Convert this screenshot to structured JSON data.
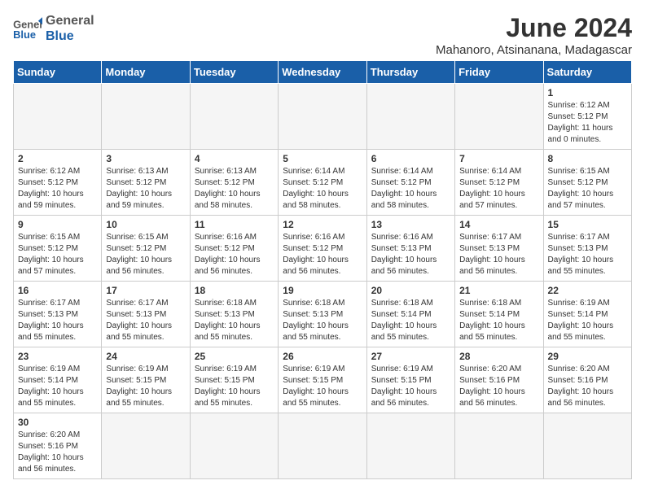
{
  "header": {
    "logo_general": "General",
    "logo_blue": "Blue",
    "title": "June 2024",
    "subtitle": "Mahanoro, Atsinanana, Madagascar"
  },
  "weekdays": [
    "Sunday",
    "Monday",
    "Tuesday",
    "Wednesday",
    "Thursday",
    "Friday",
    "Saturday"
  ],
  "weeks": [
    [
      {
        "day": "",
        "info": ""
      },
      {
        "day": "",
        "info": ""
      },
      {
        "day": "",
        "info": ""
      },
      {
        "day": "",
        "info": ""
      },
      {
        "day": "",
        "info": ""
      },
      {
        "day": "",
        "info": ""
      },
      {
        "day": "1",
        "info": "Sunrise: 6:12 AM\nSunset: 5:12 PM\nDaylight: 11 hours\nand 0 minutes."
      }
    ],
    [
      {
        "day": "2",
        "info": "Sunrise: 6:12 AM\nSunset: 5:12 PM\nDaylight: 10 hours\nand 59 minutes."
      },
      {
        "day": "3",
        "info": "Sunrise: 6:13 AM\nSunset: 5:12 PM\nDaylight: 10 hours\nand 59 minutes."
      },
      {
        "day": "4",
        "info": "Sunrise: 6:13 AM\nSunset: 5:12 PM\nDaylight: 10 hours\nand 58 minutes."
      },
      {
        "day": "5",
        "info": "Sunrise: 6:14 AM\nSunset: 5:12 PM\nDaylight: 10 hours\nand 58 minutes."
      },
      {
        "day": "6",
        "info": "Sunrise: 6:14 AM\nSunset: 5:12 PM\nDaylight: 10 hours\nand 58 minutes."
      },
      {
        "day": "7",
        "info": "Sunrise: 6:14 AM\nSunset: 5:12 PM\nDaylight: 10 hours\nand 57 minutes."
      },
      {
        "day": "8",
        "info": "Sunrise: 6:15 AM\nSunset: 5:12 PM\nDaylight: 10 hours\nand 57 minutes."
      }
    ],
    [
      {
        "day": "9",
        "info": "Sunrise: 6:15 AM\nSunset: 5:12 PM\nDaylight: 10 hours\nand 57 minutes."
      },
      {
        "day": "10",
        "info": "Sunrise: 6:15 AM\nSunset: 5:12 PM\nDaylight: 10 hours\nand 56 minutes."
      },
      {
        "day": "11",
        "info": "Sunrise: 6:16 AM\nSunset: 5:12 PM\nDaylight: 10 hours\nand 56 minutes."
      },
      {
        "day": "12",
        "info": "Sunrise: 6:16 AM\nSunset: 5:12 PM\nDaylight: 10 hours\nand 56 minutes."
      },
      {
        "day": "13",
        "info": "Sunrise: 6:16 AM\nSunset: 5:13 PM\nDaylight: 10 hours\nand 56 minutes."
      },
      {
        "day": "14",
        "info": "Sunrise: 6:17 AM\nSunset: 5:13 PM\nDaylight: 10 hours\nand 56 minutes."
      },
      {
        "day": "15",
        "info": "Sunrise: 6:17 AM\nSunset: 5:13 PM\nDaylight: 10 hours\nand 55 minutes."
      }
    ],
    [
      {
        "day": "16",
        "info": "Sunrise: 6:17 AM\nSunset: 5:13 PM\nDaylight: 10 hours\nand 55 minutes."
      },
      {
        "day": "17",
        "info": "Sunrise: 6:17 AM\nSunset: 5:13 PM\nDaylight: 10 hours\nand 55 minutes."
      },
      {
        "day": "18",
        "info": "Sunrise: 6:18 AM\nSunset: 5:13 PM\nDaylight: 10 hours\nand 55 minutes."
      },
      {
        "day": "19",
        "info": "Sunrise: 6:18 AM\nSunset: 5:13 PM\nDaylight: 10 hours\nand 55 minutes."
      },
      {
        "day": "20",
        "info": "Sunrise: 6:18 AM\nSunset: 5:14 PM\nDaylight: 10 hours\nand 55 minutes."
      },
      {
        "day": "21",
        "info": "Sunrise: 6:18 AM\nSunset: 5:14 PM\nDaylight: 10 hours\nand 55 minutes."
      },
      {
        "day": "22",
        "info": "Sunrise: 6:19 AM\nSunset: 5:14 PM\nDaylight: 10 hours\nand 55 minutes."
      }
    ],
    [
      {
        "day": "23",
        "info": "Sunrise: 6:19 AM\nSunset: 5:14 PM\nDaylight: 10 hours\nand 55 minutes."
      },
      {
        "day": "24",
        "info": "Sunrise: 6:19 AM\nSunset: 5:15 PM\nDaylight: 10 hours\nand 55 minutes."
      },
      {
        "day": "25",
        "info": "Sunrise: 6:19 AM\nSunset: 5:15 PM\nDaylight: 10 hours\nand 55 minutes."
      },
      {
        "day": "26",
        "info": "Sunrise: 6:19 AM\nSunset: 5:15 PM\nDaylight: 10 hours\nand 55 minutes."
      },
      {
        "day": "27",
        "info": "Sunrise: 6:19 AM\nSunset: 5:15 PM\nDaylight: 10 hours\nand 56 minutes."
      },
      {
        "day": "28",
        "info": "Sunrise: 6:20 AM\nSunset: 5:16 PM\nDaylight: 10 hours\nand 56 minutes."
      },
      {
        "day": "29",
        "info": "Sunrise: 6:20 AM\nSunset: 5:16 PM\nDaylight: 10 hours\nand 56 minutes."
      }
    ],
    [
      {
        "day": "30",
        "info": "Sunrise: 6:20 AM\nSunset: 5:16 PM\nDaylight: 10 hours\nand 56 minutes."
      },
      {
        "day": "",
        "info": ""
      },
      {
        "day": "",
        "info": ""
      },
      {
        "day": "",
        "info": ""
      },
      {
        "day": "",
        "info": ""
      },
      {
        "day": "",
        "info": ""
      },
      {
        "day": "",
        "info": ""
      }
    ]
  ]
}
